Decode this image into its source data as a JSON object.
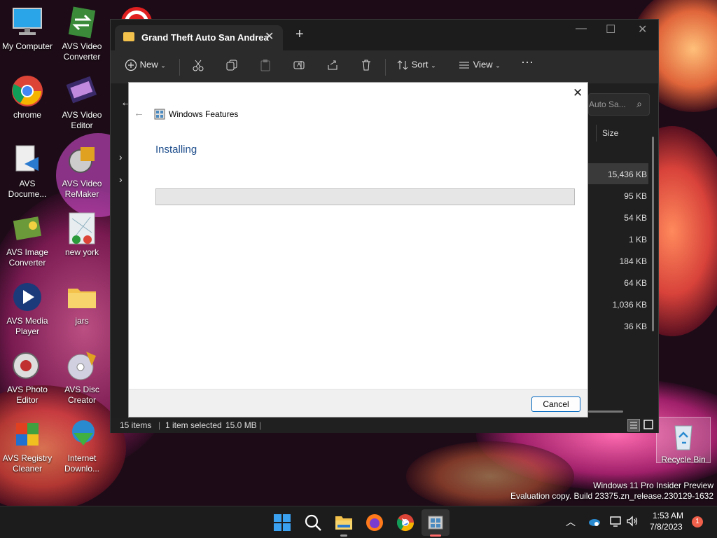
{
  "desktop": {
    "icons": [
      {
        "label": "My Computer"
      },
      {
        "label": "AVS Video Converter"
      },
      {
        "label": "chrome"
      },
      {
        "label": "AVS Video Editor"
      },
      {
        "label": "AVS Docume..."
      },
      {
        "label": "AVS Video ReMaker"
      },
      {
        "label": "AVS Image Converter"
      },
      {
        "label": "new york"
      },
      {
        "label": "AVS Media Player"
      },
      {
        "label": "jars"
      },
      {
        "label": "AVS Photo Editor"
      },
      {
        "label": "AVS Disc Creator"
      },
      {
        "label": "AVS Registry Cleaner"
      },
      {
        "label": "Internet Downlo..."
      }
    ],
    "recycle_bin": "Recycle Bin",
    "watermark_line1": "Windows 11 Pro Insider Preview",
    "watermark_line2": "Evaluation copy. Build 23375.zn_release.230129-1632"
  },
  "explorer": {
    "tab_title": "Grand Theft Auto San Andrea",
    "toolbar": {
      "new_label": "New",
      "sort_label": "Sort",
      "view_label": "View"
    },
    "search_placeholder": "Auto Sa...",
    "column_size": "Size",
    "sizes": [
      "15,436 KB",
      "95 KB",
      "54 KB",
      "1 KB",
      "184 KB",
      "64 KB",
      "1,036 KB",
      "36 KB"
    ],
    "status_items": "15 items",
    "status_selected": "1 item selected",
    "status_size": "15.0 MB"
  },
  "dialog": {
    "title": "Windows Features",
    "heading": "Installing",
    "progress": 0,
    "cancel_label": "Cancel"
  },
  "taskbar": {
    "time": "1:53 AM",
    "date": "7/8/2023",
    "notification_count": "1"
  },
  "colors": {
    "accent": "#0067c0",
    "heading": "#1e4e8c",
    "folder": "#f3c24d"
  }
}
